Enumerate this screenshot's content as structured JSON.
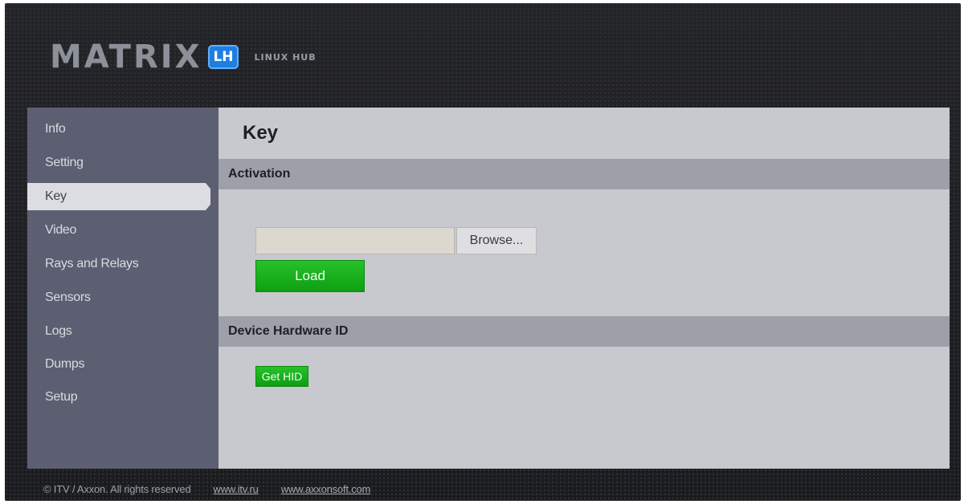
{
  "header": {
    "logo_text": "MATRIX",
    "logo_badge": "LH",
    "logo_subtitle": "LINUX HUB"
  },
  "sidebar": {
    "items": [
      {
        "label": "Info"
      },
      {
        "label": "Setting"
      },
      {
        "label": "Key",
        "active": true
      },
      {
        "label": "Video"
      },
      {
        "label": "Rays and Relays"
      },
      {
        "label": "Sensors"
      },
      {
        "label": "Logs"
      },
      {
        "label": "Dumps"
      },
      {
        "label": "Setup"
      }
    ]
  },
  "main": {
    "title": "Key",
    "activation": {
      "section_title": "Activation",
      "file_value": "",
      "browse_label": "Browse...",
      "load_label": "Load"
    },
    "hardware": {
      "section_title": "Device Hardware ID",
      "get_hid_label": "Get HID"
    }
  },
  "footer": {
    "copyright": "© ITV / Axxon. All rights reserved",
    "links": [
      "www.itv.ru",
      "www.axxonsoft.com"
    ]
  },
  "colors": {
    "sidebar_bg": "#5c5f71",
    "content_bg": "#c7c9cf",
    "section_bar_bg": "#9da0a8",
    "button_green": "#14a817",
    "badge_blue": "#1f7fe0"
  }
}
